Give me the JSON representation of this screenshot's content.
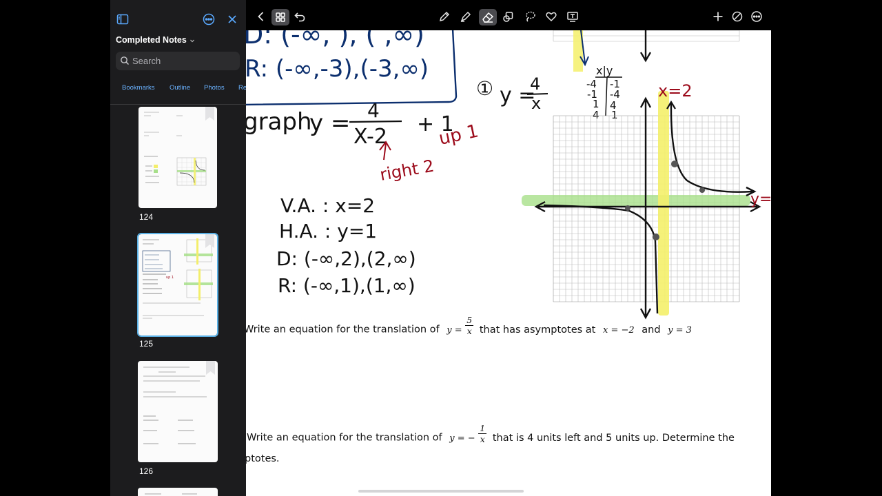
{
  "sidebar": {
    "title": "Completed Notes",
    "search_placeholder": "Search",
    "tabs": [
      "Bookmarks",
      "Outline",
      "Photos",
      "Re"
    ],
    "icons": {
      "toggle": "sidebar-toggle-icon",
      "more": "ellipsis-circle-icon",
      "close": "close-icon"
    },
    "thumbnails": [
      {
        "page": "124",
        "selected": false,
        "bookmarked": true
      },
      {
        "page": "125",
        "selected": true,
        "bookmarked": true
      },
      {
        "page": "126",
        "selected": false,
        "bookmarked": true
      }
    ]
  },
  "toolbar": {
    "left": [
      "back-chevron-icon",
      "grid-view-icon",
      "undo-icon"
    ],
    "tools": [
      "pen-icon",
      "highlighter-icon",
      "eraser-icon",
      "shapes-icon",
      "lasso-icon",
      "sticker-icon",
      "text-box-icon"
    ],
    "active_tool": "eraser-icon",
    "right": [
      "add-icon",
      "disable-touch-icon",
      "more-icon"
    ],
    "accent": "#4b4b4f"
  },
  "note": {
    "handwriting": {
      "top_domain_partial": "D: (-∞, ), (  ,∞)",
      "range_line": "R: (-∞,-3),(-3,∞)",
      "example_num": "①",
      "parent_func": "y = 4/x",
      "table_header": "x|y",
      "table_rows": [
        "-4|-1",
        "-1|-4",
        "1|4",
        "4|1"
      ],
      "graph_label": "graph y = 4/(x-2) + 1",
      "shift_right": "right 2",
      "shift_up": "up 1",
      "va": "V.A. : x=2",
      "ha": "H.A. : y=1",
      "domain": "D: (-∞,2),(2,∞)",
      "range": "R: (-∞,1),(1,∞)",
      "asymptote_x": "x=2",
      "asymptote_y": "y="
    },
    "problem_1": {
      "prefix": "Write an equation for the translation of",
      "func_lhs": "y =",
      "func_num": "5",
      "func_den": "x",
      "middle": "that has asymptotes at",
      "asym_x": "x = −2",
      "and": "and",
      "asym_y": "y = 3"
    },
    "problem_2": {
      "prefix": "Write an equation for the translation of",
      "func_lhs": "y = −",
      "func_num": "1",
      "func_den": "x",
      "suffix": "that is 4 units left and 5 units up.  Determine the",
      "line2": "ptotes."
    }
  },
  "colors": {
    "ink_blue": "#0c2f6e",
    "ink_red": "#9c0b1b",
    "highlight_yellow": "#f4f06a",
    "highlight_green": "#a8e08a",
    "sidebar_bg": "#1c1c1e",
    "accent_blue": "#5aa9ff"
  }
}
